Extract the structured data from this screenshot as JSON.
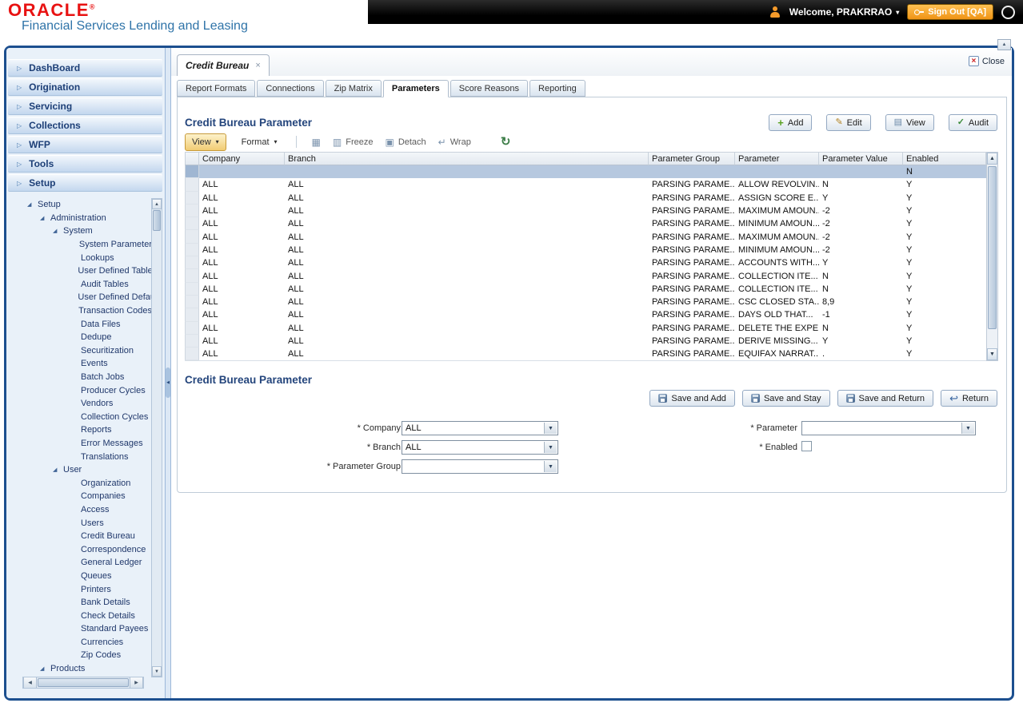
{
  "colors": {
    "oracle_red": "#e81212",
    "subtitle_blue": "#2e73a8",
    "navy_heading": "#24457c",
    "signout_orange": "#ef9416",
    "selected_row": "#b6c8df",
    "view_button_highlight": "#f1cc74",
    "frame_blue": "#1c4f8f"
  },
  "ui": {
    "menu_arrow": "▷",
    "caret": "▾",
    "dropdown_arrow": "▼",
    "up_arrow": "▲",
    "down_arrow": "▼",
    "left_arrow": "◀",
    "right_arrow": "▶",
    "close_x": "×",
    "export_glyph": "▦",
    "freeze_glyph": "▥",
    "detach_glyph": "▣",
    "wrap_glyph": "↵",
    "refresh_glyph": "↻"
  },
  "header": {
    "brand": "ORACLE",
    "reg": "®",
    "subtitle": "Financial Services Lending and Leasing",
    "welcome": "Welcome, PRAKRRAO",
    "caret": "▾",
    "sign_out": "Sign Out [QA]"
  },
  "nav": {
    "menus": [
      "DashBoard",
      "Origination",
      "Servicing",
      "Collections",
      "WFP",
      "Tools",
      "Setup"
    ]
  },
  "tree": {
    "branch_glyph": "◢",
    "items": [
      {
        "label": "Setup",
        "level": 0,
        "branch": true
      },
      {
        "label": "Administration",
        "level": 1,
        "branch": true
      },
      {
        "label": "System",
        "level": 2,
        "branch": true
      },
      {
        "label": "System Parameter",
        "level": 3,
        "branch": false
      },
      {
        "label": "Lookups",
        "level": 3,
        "branch": false
      },
      {
        "label": "User Defined Tables",
        "level": 3,
        "branch": false
      },
      {
        "label": "Audit Tables",
        "level": 3,
        "branch": false
      },
      {
        "label": "User Defined Default",
        "level": 3,
        "branch": false
      },
      {
        "label": "Transaction Codes",
        "level": 3,
        "branch": false
      },
      {
        "label": "Data Files",
        "level": 3,
        "branch": false
      },
      {
        "label": "Dedupe",
        "level": 3,
        "branch": false
      },
      {
        "label": "Securitization",
        "level": 3,
        "branch": false
      },
      {
        "label": "Events",
        "level": 3,
        "branch": false
      },
      {
        "label": "Batch Jobs",
        "level": 3,
        "branch": false
      },
      {
        "label": "Producer Cycles",
        "level": 3,
        "branch": false
      },
      {
        "label": "Vendors",
        "level": 3,
        "branch": false
      },
      {
        "label": "Collection Cycles",
        "level": 3,
        "branch": false
      },
      {
        "label": "Reports",
        "level": 3,
        "branch": false
      },
      {
        "label": "Error Messages",
        "level": 3,
        "branch": false
      },
      {
        "label": "Translations",
        "level": 3,
        "branch": false
      },
      {
        "label": "User",
        "level": 2,
        "branch": true
      },
      {
        "label": "Organization",
        "level": 3,
        "branch": false
      },
      {
        "label": "Companies",
        "level": 3,
        "branch": false
      },
      {
        "label": "Access",
        "level": 3,
        "branch": false
      },
      {
        "label": "Users",
        "level": 3,
        "branch": false
      },
      {
        "label": "Credit Bureau",
        "level": 3,
        "branch": false
      },
      {
        "label": "Correspondence",
        "level": 3,
        "branch": false
      },
      {
        "label": "General Ledger",
        "level": 3,
        "branch": false
      },
      {
        "label": "Queues",
        "level": 3,
        "branch": false
      },
      {
        "label": "Printers",
        "level": 3,
        "branch": false
      },
      {
        "label": "Bank Details",
        "level": 3,
        "branch": false
      },
      {
        "label": "Check Details",
        "level": 3,
        "branch": false
      },
      {
        "label": "Standard Payees",
        "level": 3,
        "branch": false
      },
      {
        "label": "Currencies",
        "level": 3,
        "branch": false
      },
      {
        "label": "Zip Codes",
        "level": 3,
        "branch": false
      },
      {
        "label": "Products",
        "level": 1,
        "branch": true
      }
    ]
  },
  "workspace": {
    "tab": {
      "label": "Credit Bureau",
      "close": "×"
    },
    "close_label": "Close",
    "subtabs": [
      {
        "label": "Report Formats",
        "active": false
      },
      {
        "label": "Connections",
        "active": false
      },
      {
        "label": "Zip Matrix",
        "active": false
      },
      {
        "label": "Parameters",
        "active": true
      },
      {
        "label": "Score Reasons",
        "active": false
      },
      {
        "label": "Reporting",
        "active": false
      }
    ]
  },
  "grid": {
    "title": "Credit Bureau Parameter",
    "actions": [
      {
        "label": "Add",
        "icon": "add",
        "glyph": "+"
      },
      {
        "label": "Edit",
        "icon": "edit",
        "glyph": "✎"
      },
      {
        "label": "View",
        "icon": "view",
        "glyph": "▤"
      },
      {
        "label": "Audit",
        "icon": "audit",
        "glyph": "✓"
      }
    ],
    "toolbar": {
      "view": "View",
      "format": "Format",
      "freeze": "Freeze",
      "detach": "Detach",
      "wrap": "Wrap"
    },
    "columns": [
      "Company",
      "Branch",
      "Parameter Group",
      "Parameter",
      "Parameter Value",
      "Enabled"
    ],
    "rows": [
      {
        "company": "",
        "branch": "",
        "group": "",
        "parameter": "",
        "value": "",
        "enabled": "N",
        "selected": true
      },
      {
        "company": "ALL",
        "branch": "ALL",
        "group": "PARSING PARAME...",
        "parameter": "ALLOW REVOLVIN...",
        "value": "N",
        "enabled": "Y",
        "selected": false
      },
      {
        "company": "ALL",
        "branch": "ALL",
        "group": "PARSING PARAME...",
        "parameter": "ASSIGN SCORE E...",
        "value": "Y",
        "enabled": "Y",
        "selected": false
      },
      {
        "company": "ALL",
        "branch": "ALL",
        "group": "PARSING PARAME...",
        "parameter": "MAXIMUM AMOUN...",
        "value": "-2",
        "enabled": "Y",
        "selected": false
      },
      {
        "company": "ALL",
        "branch": "ALL",
        "group": "PARSING PARAME...",
        "parameter": "MINIMUM AMOUN...",
        "value": "-2",
        "enabled": "Y",
        "selected": false
      },
      {
        "company": "ALL",
        "branch": "ALL",
        "group": "PARSING PARAME...",
        "parameter": "MAXIMUM AMOUN...",
        "value": "-2",
        "enabled": "Y",
        "selected": false
      },
      {
        "company": "ALL",
        "branch": "ALL",
        "group": "PARSING PARAME...",
        "parameter": "MINIMUM AMOUN...",
        "value": "-2",
        "enabled": "Y",
        "selected": false
      },
      {
        "company": "ALL",
        "branch": "ALL",
        "group": "PARSING PARAME...",
        "parameter": "ACCOUNTS WITH...",
        "value": "Y",
        "enabled": "Y",
        "selected": false
      },
      {
        "company": "ALL",
        "branch": "ALL",
        "group": "PARSING PARAME...",
        "parameter": "COLLECTION ITE...",
        "value": "N",
        "enabled": "Y",
        "selected": false
      },
      {
        "company": "ALL",
        "branch": "ALL",
        "group": "PARSING PARAME...",
        "parameter": "COLLECTION ITE...",
        "value": "N",
        "enabled": "Y",
        "selected": false
      },
      {
        "company": "ALL",
        "branch": "ALL",
        "group": "PARSING PARAME...",
        "parameter": "CSC CLOSED STA...",
        "value": "8,9",
        "enabled": "Y",
        "selected": false
      },
      {
        "company": "ALL",
        "branch": "ALL",
        "group": "PARSING PARAME...",
        "parameter": "DAYS OLD THAT...",
        "value": "-1",
        "enabled": "Y",
        "selected": false
      },
      {
        "company": "ALL",
        "branch": "ALL",
        "group": "PARSING PARAME...",
        "parameter": "DELETE THE EXPE...",
        "value": "N",
        "enabled": "Y",
        "selected": false
      },
      {
        "company": "ALL",
        "branch": "ALL",
        "group": "PARSING PARAME...",
        "parameter": "DERIVE MISSING...",
        "value": "Y",
        "enabled": "Y",
        "selected": false
      },
      {
        "company": "ALL",
        "branch": "ALL",
        "group": "PARSING PARAME...",
        "parameter": "EQUIFAX NARRAT...",
        "value": ".",
        "enabled": "Y",
        "selected": false
      }
    ]
  },
  "form": {
    "title": "Credit Bureau Parameter",
    "buttons": [
      {
        "label": "Save and Add",
        "icon": "save",
        "glyph": ""
      },
      {
        "label": "Save and Stay",
        "icon": "save",
        "glyph": ""
      },
      {
        "label": "Save and Return",
        "icon": "save",
        "glyph": ""
      },
      {
        "label": "Return",
        "icon": "return",
        "glyph": "↩"
      }
    ],
    "fields": {
      "company": {
        "required": "*",
        "label": "Company",
        "value": "ALL"
      },
      "branch": {
        "required": "*",
        "label": "Branch",
        "value": "ALL"
      },
      "parameter_group": {
        "required": "*",
        "label": "Parameter Group",
        "value": ""
      },
      "parameter": {
        "required": "*",
        "label": "Parameter",
        "value": ""
      },
      "enabled": {
        "required": "*",
        "label": "Enabled",
        "checked": false
      }
    }
  }
}
